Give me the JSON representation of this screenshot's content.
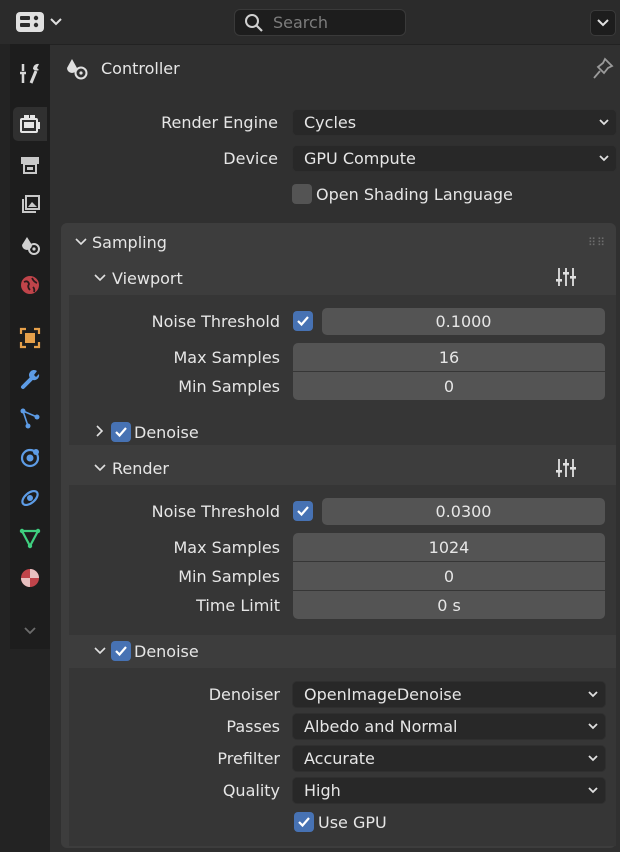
{
  "header": {
    "search_placeholder": "Search"
  },
  "context": {
    "title": "Controller"
  },
  "render": {
    "engine_label": "Render Engine",
    "engine_value": "Cycles",
    "device_label": "Device",
    "device_value": "GPU Compute",
    "osl_label": "Open Shading Language",
    "osl_checked": false
  },
  "sampling": {
    "title": "Sampling",
    "viewport": {
      "title": "Viewport",
      "noise_label": "Noise Threshold",
      "noise_enabled": true,
      "noise_value": "0.1000",
      "max_label": "Max Samples",
      "max_value": "16",
      "min_label": "Min Samples",
      "min_value": "0",
      "denoise_label": "Denoise",
      "denoise_checked": true
    },
    "render": {
      "title": "Render",
      "noise_label": "Noise Threshold",
      "noise_enabled": true,
      "noise_value": "0.0300",
      "max_label": "Max Samples",
      "max_value": "1024",
      "min_label": "Min Samples",
      "min_value": "0",
      "time_label": "Time Limit",
      "time_value": "0 s",
      "denoise": {
        "title": "Denoise",
        "checked": true,
        "denoiser_label": "Denoiser",
        "denoiser_value": "OpenImageDenoise",
        "passes_label": "Passes",
        "passes_value": "Albedo and Normal",
        "prefilter_label": "Prefilter",
        "prefilter_value": "Accurate",
        "quality_label": "Quality",
        "quality_value": "High",
        "gpu_label": "Use GPU",
        "gpu_checked": true
      }
    }
  },
  "colors": {
    "accent": "#4772b3",
    "panel_bg": "#303030",
    "field_bg": "#545454"
  },
  "icons": {
    "tabs": [
      "tool-icon",
      "render-icon",
      "output-icon",
      "view-layer-icon",
      "scene-icon",
      "world-icon",
      "object-icon",
      "modifier-icon",
      "particles-icon",
      "physics-icon",
      "constraints-icon",
      "data-icon",
      "material-icon"
    ]
  }
}
